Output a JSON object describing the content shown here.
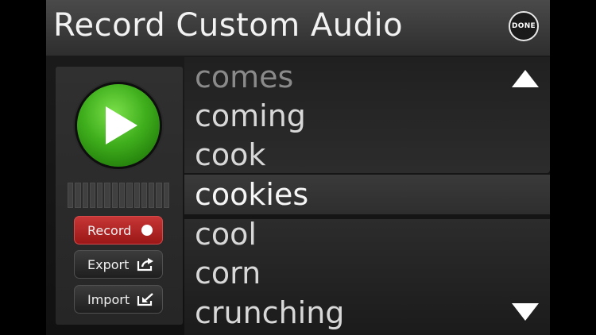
{
  "header": {
    "title": "Record Custom Audio",
    "done_label": "DONE"
  },
  "controls": {
    "play_icon": "play-icon",
    "meter_level": 0,
    "record_label": "Record",
    "export_label": "Export",
    "import_label": "Import"
  },
  "word_list": {
    "items": [
      "comes",
      "coming",
      "cook",
      "cookies",
      "cool",
      "corn",
      "crunching"
    ],
    "selected": "cookies",
    "scroll_up_icon": "triangle-up-icon",
    "scroll_down_icon": "triangle-down-icon"
  },
  "colors": {
    "play_green": "#3fae1c",
    "record_red": "#b52626"
  }
}
